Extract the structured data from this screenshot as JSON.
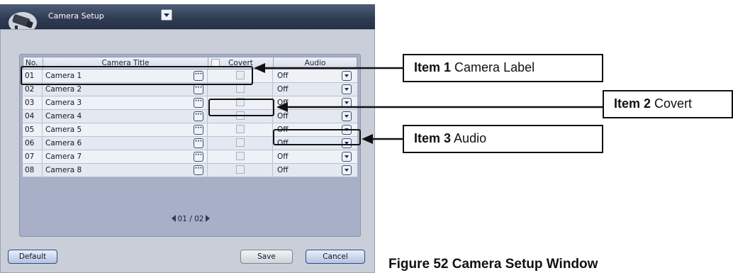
{
  "window": {
    "title": "Camera Setup"
  },
  "table": {
    "headers": {
      "no": "No.",
      "title": "Camera Title",
      "covert": "Covert",
      "audio": "Audio"
    },
    "rows": [
      {
        "no": "01",
        "title": "Camera 1",
        "audio": "Off"
      },
      {
        "no": "02",
        "title": "Camera 2",
        "audio": "Off"
      },
      {
        "no": "03",
        "title": "Camera 3",
        "audio": "Off"
      },
      {
        "no": "04",
        "title": "Camera 4",
        "audio": "Off"
      },
      {
        "no": "05",
        "title": "Camera 5",
        "audio": "Off"
      },
      {
        "no": "06",
        "title": "Camera 6",
        "audio": "Off"
      },
      {
        "no": "07",
        "title": "Camera 7",
        "audio": "Off"
      },
      {
        "no": "08",
        "title": "Camera 8",
        "audio": "Off"
      }
    ],
    "pager": "01 / 02"
  },
  "buttons": {
    "default": "Default",
    "save": "Save",
    "cancel": "Cancel"
  },
  "callouts": {
    "item1": {
      "label": "Item 1",
      "text": "Camera Label"
    },
    "item2": {
      "label": "Item 2",
      "text": "Covert"
    },
    "item3": {
      "label": "Item 3",
      "text": "Audio"
    }
  },
  "caption": "Figure 52 Camera Setup Window",
  "icons": {
    "title": "camera-icon",
    "title_dropdown": "chevron-down-icon",
    "edit": "ellipsis-icon",
    "dropdown": "chevron-down-icon",
    "prev": "triangle-left-icon",
    "next": "triangle-right-icon"
  }
}
